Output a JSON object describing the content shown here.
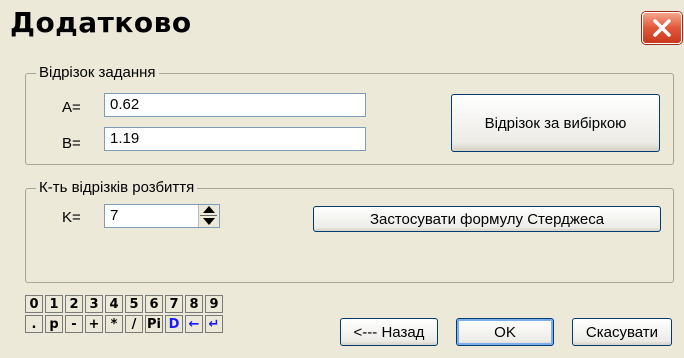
{
  "window": {
    "title": "Додатково",
    "close_icon": "close-icon"
  },
  "segment_group": {
    "legend": "Відрізок задання",
    "a_label": "A=",
    "a_value": "0.62",
    "b_label": "B=",
    "b_value": "1.19",
    "sample_button_label": "Відрізок за вибіркою"
  },
  "partition_group": {
    "legend": "К-ть відрізків розбиття",
    "k_label": "K=",
    "k_value": "7",
    "sturges_button_label": "Застосувати формулу  Стерджеса"
  },
  "keypad": {
    "row1": [
      "0",
      "1",
      "2",
      "3",
      "4",
      "5",
      "6",
      "7",
      "8",
      "9"
    ],
    "row2": [
      ".",
      "p",
      "-",
      "+",
      "*",
      "/",
      "Pi",
      "D",
      "←",
      "↵"
    ],
    "blue_keys": [
      "D",
      "←",
      "↵"
    ]
  },
  "footer": {
    "back_label": "<--- Назад",
    "ok_label": "OK",
    "cancel_label": "Скасувати"
  },
  "colors": {
    "dialog_bg": "#ece9d8",
    "close_button": "#e2573a",
    "key_accent": "#1a1aff"
  }
}
